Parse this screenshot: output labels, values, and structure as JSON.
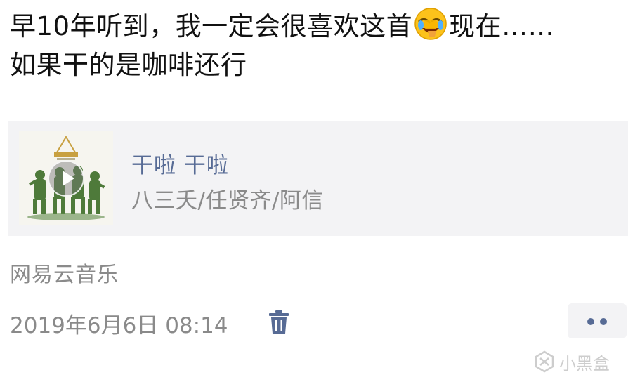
{
  "post": {
    "text_part1": "早10年听到，我一定会很喜欢这首",
    "emoji_name": "laughing-crying-face-icon",
    "text_part2": "现在……如果干的是咖啡还行"
  },
  "music_card": {
    "title": "干啦 干啦",
    "artist": "八三夭/任贤齐/阿信",
    "cover_icon": "album-cover-soldiers",
    "play_icon": "play-icon"
  },
  "source": "网易云音乐",
  "timestamp": "2019年6月6日 08:14",
  "actions": {
    "delete_icon": "trash-icon",
    "more_icon": "more-dots-icon"
  },
  "watermark": "小黑盒",
  "colors": {
    "link": "#576b95",
    "secondary_text": "#8a8a8a",
    "card_bg": "#f3f3f5"
  }
}
